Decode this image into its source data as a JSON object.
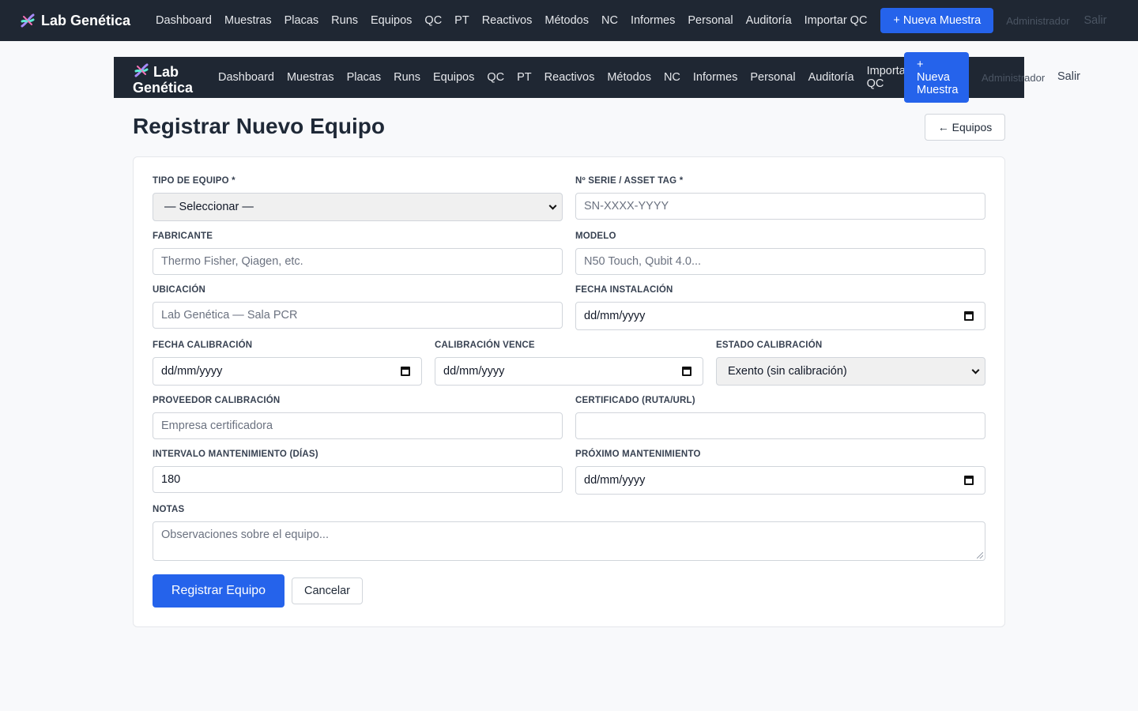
{
  "app": {
    "brand": "Lab Genética"
  },
  "nav": {
    "items": [
      "Dashboard",
      "Muestras",
      "Placas",
      "Runs",
      "Equipos",
      "QC",
      "PT",
      "Reactivos",
      "Métodos",
      "NC",
      "Informes",
      "Personal",
      "Auditoría",
      "Importar QC"
    ],
    "new_sample": "+ Nueva Muestra",
    "user": "Administrador",
    "logout": "Salir"
  },
  "inner_nav": {
    "brand_line1": "Lab",
    "brand_line2": "Genética",
    "import_line1": "Importar",
    "import_line2": "QC",
    "new_line1": "+",
    "new_line2": "Nueva",
    "new_line3": "Muestra"
  },
  "page": {
    "title": "Registrar Nuevo Equipo",
    "back": "← Equipos"
  },
  "form": {
    "tipo": {
      "label": "Tipo de Equipo *",
      "value": "— Seleccionar —"
    },
    "serie": {
      "label": "Nº Serie / Asset Tag *",
      "placeholder": "SN-XXXX-YYYY"
    },
    "fabricante": {
      "label": "Fabricante",
      "placeholder": "Thermo Fisher, Qiagen, etc."
    },
    "modelo": {
      "label": "Modelo",
      "placeholder": "N50 Touch, Qubit 4.0..."
    },
    "ubicacion": {
      "label": "Ubicación",
      "placeholder": "Lab Genética — Sala PCR"
    },
    "fecha_instalacion": {
      "label": "Fecha Instalación",
      "value": "dd/mm/yyyy"
    },
    "fecha_calibracion": {
      "label": "Fecha Calibración",
      "value": "dd/mm/yyyy"
    },
    "calibracion_vence": {
      "label": "Calibración Vence",
      "value": "dd/mm/yyyy"
    },
    "estado_calibracion": {
      "label": "Estado Calibración",
      "value": "Exento (sin calibración)"
    },
    "proveedor": {
      "label": "Proveedor Calibración",
      "placeholder": "Empresa certificadora"
    },
    "certificado": {
      "label": "Certificado (Ruta/URL)",
      "value": ""
    },
    "intervalo": {
      "label": "Intervalo Mantenimiento (Días)",
      "value": "180"
    },
    "proximo": {
      "label": "Próximo Mantenimiento",
      "value": "dd/mm/yyyy"
    },
    "notas": {
      "label": "Notas",
      "placeholder": "Observaciones sobre el equipo..."
    },
    "submit": "Registrar Equipo",
    "cancel": "Cancelar"
  }
}
